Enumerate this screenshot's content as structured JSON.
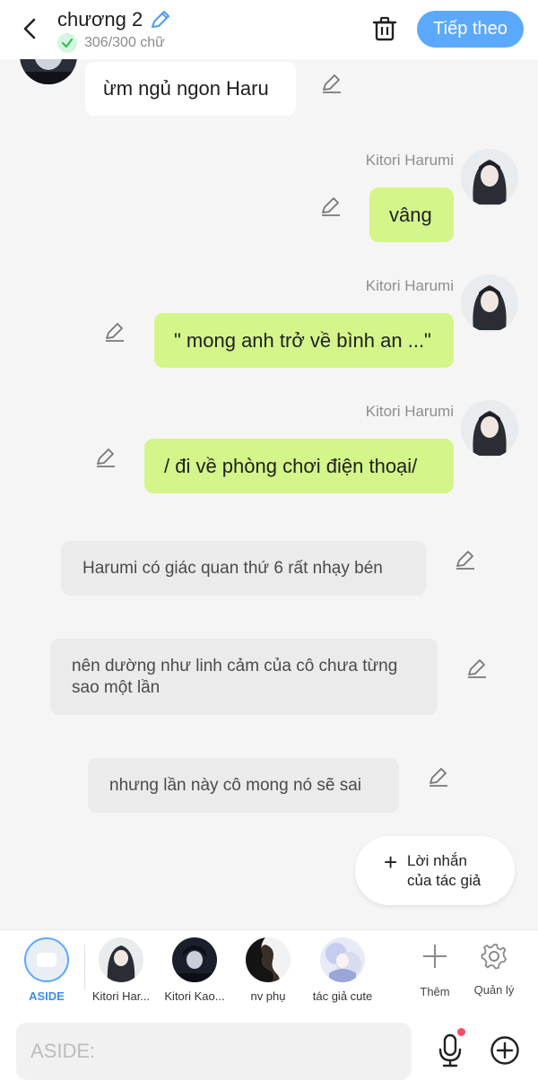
{
  "header": {
    "title": "chương 2",
    "word_count": "306/300 chữ",
    "next_label": "Tiếp theo"
  },
  "messages": [
    {
      "sender": "",
      "text": "ừm ngủ ngon Haru"
    },
    {
      "sender": "Kitori Harumi",
      "text": "vâng"
    },
    {
      "sender": "Kitori Harumi",
      "text": "\" mong anh trở về bình an ...\""
    },
    {
      "sender": "Kitori Harumi",
      "text": "/ đi về phòng chơi điện thoại/"
    },
    {
      "sender": "",
      "text": "Harumi có giác quan thứ 6 rất nhạy bén"
    },
    {
      "sender": "",
      "text": "nên dường như linh cảm của cô chưa từng sao một lần"
    },
    {
      "sender": "",
      "text": "nhưng lần này cô mong nó sẽ sai"
    }
  ],
  "author_note": {
    "line1": "Lời nhắn",
    "line2": "của tác giả"
  },
  "characters": [
    {
      "name": "ASIDE"
    },
    {
      "name": "Kitori Har..."
    },
    {
      "name": "Kitori Kao..."
    },
    {
      "name": "nv phụ"
    },
    {
      "name": "tác giả cute"
    }
  ],
  "tools": {
    "add_label": "Thêm",
    "manage_label": "Quản lý"
  },
  "input": {
    "placeholder": "ASIDE:"
  },
  "colors": {
    "accent": "#5aa9ff",
    "bubble_green": "#d4f58a",
    "bubble_gray": "#ebebeb",
    "notification_dot": "#ff4a63"
  }
}
